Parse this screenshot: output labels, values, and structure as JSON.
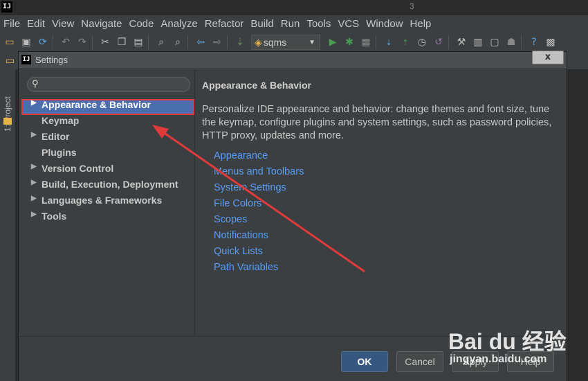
{
  "titlebar": {
    "logo": "IJ",
    "text": "3"
  },
  "menu": [
    "File",
    "Edit",
    "View",
    "Navigate",
    "Code",
    "Analyze",
    "Refactor",
    "Build",
    "Run",
    "Tools",
    "VCS",
    "Window",
    "Help"
  ],
  "toolbar": {
    "run_config": "sqms",
    "icons": [
      "open-folder-icon",
      "save-icon",
      "sync-icon",
      "undo-icon",
      "redo-icon",
      "cut-icon",
      "copy-icon",
      "paste-icon",
      "find-icon",
      "replace-icon",
      "back-icon",
      "forward-icon",
      "build-icon",
      "run-config-icon",
      "run-icon",
      "debug-icon",
      "coverage-icon",
      "vcs-update-icon",
      "vcs-commit-icon",
      "vcs-history-icon",
      "revert-icon",
      "settings-icon",
      "project-structure-icon",
      "sdk-icon",
      "android-icon",
      "help-icon",
      "plugin-icon"
    ]
  },
  "left_strip": {
    "project_tab": "1: Project"
  },
  "dialog": {
    "icon": "IJ",
    "title": "Settings",
    "close_label": "x",
    "search_placeholder": "",
    "tree": [
      {
        "label": "Appearance & Behavior",
        "expandable": true,
        "selected": true
      },
      {
        "label": "Keymap",
        "expandable": false,
        "selected": false
      },
      {
        "label": "Editor",
        "expandable": true,
        "selected": false
      },
      {
        "label": "Plugins",
        "expandable": false,
        "selected": false
      },
      {
        "label": "Version Control",
        "expandable": true,
        "selected": false
      },
      {
        "label": "Build, Execution, Deployment",
        "expandable": true,
        "selected": false
      },
      {
        "label": "Languages & Frameworks",
        "expandable": true,
        "selected": false
      },
      {
        "label": "Tools",
        "expandable": true,
        "selected": false
      }
    ],
    "content": {
      "title": "Appearance & Behavior",
      "description": "Personalize IDE appearance and behavior: change themes and font size, tune the keymap, configure plugins and system settings, such as password policies, HTTP proxy, updates and more.",
      "links": [
        "Appearance",
        "Menus and Toolbars",
        "System Settings",
        "File Colors",
        "Scopes",
        "Notifications",
        "Quick Lists",
        "Path Variables"
      ]
    },
    "buttons": {
      "ok": "OK",
      "cancel": "Cancel",
      "apply": "Apply",
      "help": "Help"
    }
  },
  "watermark": {
    "logo": "Bai du 经验",
    "text": "jingyan.baidu.com"
  },
  "colors": {
    "selection": "#4b6eaf",
    "link": "#589df6",
    "annotation": "#e03a3a"
  }
}
